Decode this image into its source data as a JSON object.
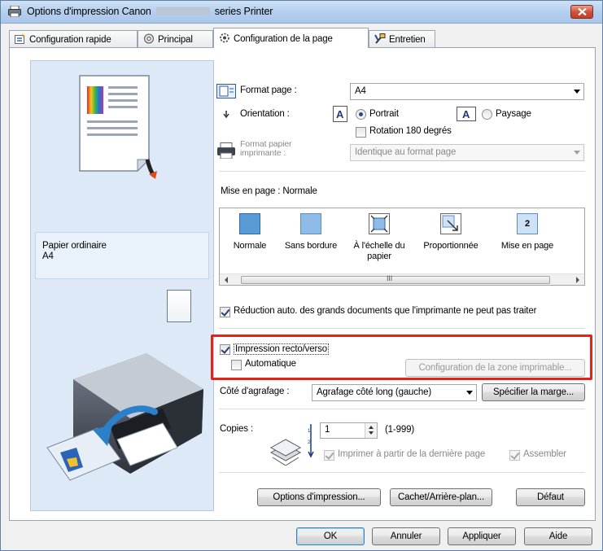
{
  "window": {
    "title_prefix": "Options d'impression Canon",
    "title_suffix": "series Printer"
  },
  "tabs": [
    {
      "label": "Configuration rapide"
    },
    {
      "label": "Principal"
    },
    {
      "label": "Configuration de la page",
      "active": true
    },
    {
      "label": "Entretien"
    }
  ],
  "preview": {
    "paper_type": "Papier ordinaire",
    "paper_size": "A4"
  },
  "page_setup": {
    "format_label": "Format page :",
    "format_value": "A4",
    "orientation_label": "Orientation :",
    "portrait_label": "Portrait",
    "landscape_label": "Paysage",
    "orientation_selected": "Portrait",
    "rotate_label": "Rotation 180 degrés",
    "rotate_checked": false,
    "printer_paper_label_1": "Format papier",
    "printer_paper_label_2": "imprimante :",
    "printer_paper_value": "Identique au format page",
    "layout_label": "Mise en page :",
    "layout_value": "Normale",
    "layouts": [
      {
        "name": "normal",
        "line1": "Normale",
        "line2": ""
      },
      {
        "name": "borderless",
        "line1": "Sans bordure",
        "line2": ""
      },
      {
        "name": "fit-to-page",
        "line1": "À l'échelle du",
        "line2": "papier"
      },
      {
        "name": "scaled",
        "line1": "Proportionnée",
        "line2": ""
      },
      {
        "name": "page-layout",
        "line1": "Mise en page",
        "line2": ""
      }
    ],
    "layout_page_count": "2",
    "scroll_dots": "III",
    "auto_reduce_label": "Réduction auto. des grands documents que l'imprimante ne peut pas traiter",
    "auto_reduce_checked": true,
    "duplex_label": "Impression recto/verso",
    "duplex_checked": true,
    "automatic_label": "Automatique",
    "automatic_checked": false,
    "print_area_button": "Configuration de la zone imprimable...",
    "stapling_label": "Côté d'agrafage :",
    "stapling_value": "Agrafage côté long (gauche)",
    "margin_button": "Spécifier la marge...",
    "copies_label": "Copies :",
    "copies_value": "1",
    "copies_range": "(1-999)",
    "reverse_label": "Imprimer à partir de la dernière page",
    "reverse_checked": true,
    "collate_label": "Assembler",
    "collate_checked": true
  },
  "bottom_buttons": {
    "print_options": "Options d'impression...",
    "stamp_background": "Cachet/Arrière-plan...",
    "defaults": "Défaut"
  },
  "dialog_buttons": {
    "ok": "OK",
    "cancel": "Annuler",
    "apply": "Appliquer",
    "help": "Aide"
  },
  "colors": {
    "highlight_border": "#e2231a",
    "preview_background": "#dde9f7",
    "layout_selected": "#5b9bd5"
  }
}
